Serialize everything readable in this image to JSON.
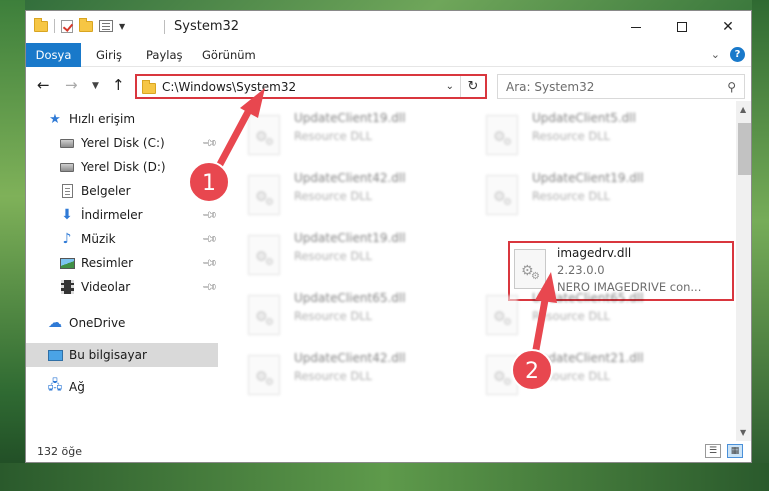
{
  "window": {
    "title": "System32"
  },
  "ribbon": {
    "tabs": [
      "Dosya",
      "Giriş",
      "Paylaş",
      "Görünüm"
    ]
  },
  "nav": {
    "address": "C:\\Windows\\System32",
    "search_placeholder": "Ara: System32"
  },
  "sidebar": {
    "items": [
      {
        "label": "Hızlı erişim",
        "icon": "star-icon"
      },
      {
        "label": "Yerel Disk (C:)",
        "icon": "drive-icon",
        "pinned": true
      },
      {
        "label": "Yerel Disk (D:)",
        "icon": "drive-icon"
      },
      {
        "label": "Belgeler",
        "icon": "documents-icon"
      },
      {
        "label": "İndirmeler",
        "icon": "downloads-icon",
        "pinned": true
      },
      {
        "label": "Müzik",
        "icon": "music-icon",
        "pinned": true
      },
      {
        "label": "Resimler",
        "icon": "pictures-icon",
        "pinned": true
      },
      {
        "label": "Videolar",
        "icon": "videos-icon",
        "pinned": true
      },
      {
        "label": "OneDrive",
        "icon": "cloud-icon"
      },
      {
        "label": "Bu bilgisayar",
        "icon": "computer-icon",
        "selected": true
      },
      {
        "label": "Ağ",
        "icon": "network-icon"
      }
    ]
  },
  "files": [
    {
      "name": "UpdateClient19.dll",
      "type": "Resource DLL"
    },
    {
      "name": "UpdateClient5.dll",
      "type": "Resource DLL"
    },
    {
      "name": "UpdateClient42.dll",
      "type": "Resource DLL"
    },
    {
      "name": "UpdateClient19.dll",
      "type": "Resource DLL"
    },
    {
      "name": "UpdateClient19.dll",
      "type": "Resource DLL"
    },
    {
      "name": "imagedrv.dll",
      "version": "2.23.0.0",
      "type": "NERO IMAGEDRIVE con...",
      "highlighted": true
    },
    {
      "name": "UpdateClient65.dll",
      "type": "Resource DLL"
    },
    {
      "name": "UpdateClient65.dll",
      "type": "Resource DLL"
    },
    {
      "name": "UpdateClient42.dll",
      "type": "Resource DLL"
    },
    {
      "name": "UpdateClient21.dll",
      "type": "Resource DLL"
    }
  ],
  "status": {
    "item_count": "132 öğe"
  },
  "annotations": {
    "step1": "1",
    "step2": "2",
    "color": "#e8474f"
  }
}
